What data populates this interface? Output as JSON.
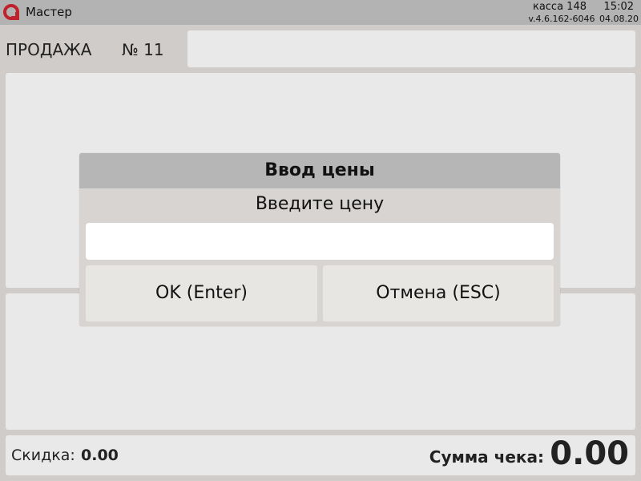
{
  "topbar": {
    "app_title": "Мастер",
    "kassa": "касса 148",
    "time": "15:02",
    "version": "v.4.6.162-6046 04.08.20",
    "logo_icon": "cashier-logo-icon",
    "brand_color": "#c0222c"
  },
  "sale": {
    "title": "ПРОДАЖА",
    "number": "№ 11"
  },
  "footer": {
    "discount_label": "Скидка:",
    "discount_value": "0.00",
    "total_label": "Сумма чека:",
    "total_value": "0.00"
  },
  "dialog": {
    "title": "Ввод цены",
    "prompt": "Введите цену",
    "input_value": "",
    "ok_label": "OK (Enter)",
    "cancel_label": "Отмена (ESC)"
  }
}
